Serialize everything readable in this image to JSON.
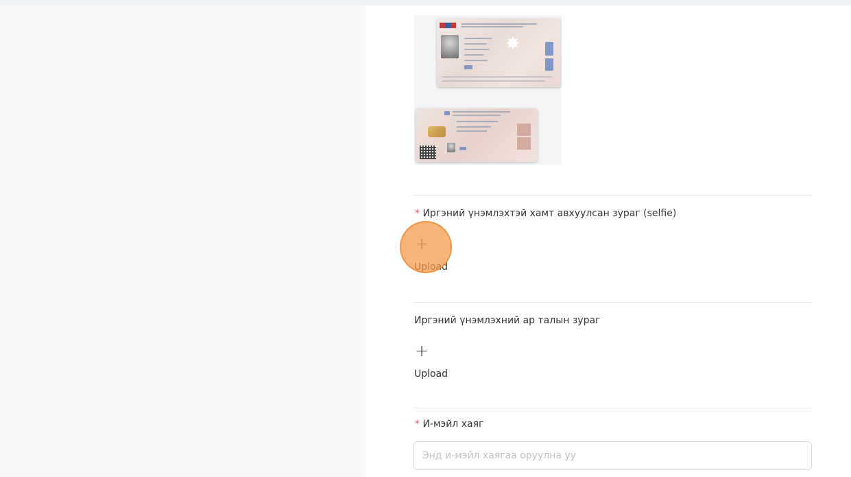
{
  "top_hint": "...",
  "sections": {
    "selfie": {
      "required_mark": "*",
      "label": "Иргэний үнэмлэхтэй хамт авхуулсан зураг (selfie)",
      "plus": "+",
      "upload_label": "Upload"
    },
    "id_back": {
      "label": "Иргэний үнэмлэхний ар талын зураг",
      "plus": "+",
      "upload_label": "Upload"
    },
    "email": {
      "required_mark": "*",
      "label": "И-мэйл хаяг",
      "value": "",
      "placeholder": "Энд и-мэйл хаягаа оруулна уу"
    }
  },
  "colors": {
    "required": "#ff4d4f",
    "click_marker": "#f59846",
    "divider": "#e8e8e8",
    "input_border": "#d9d9d9"
  }
}
